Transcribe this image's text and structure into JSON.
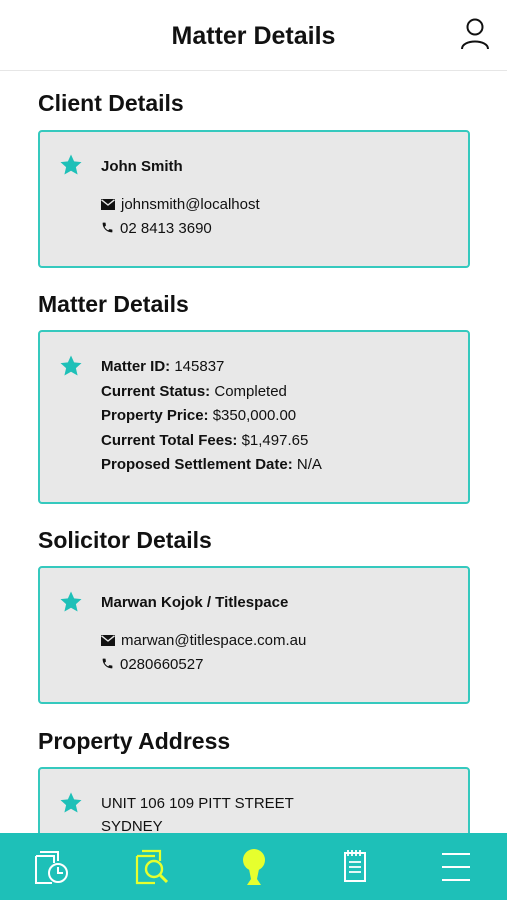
{
  "header": {
    "title": "Matter Details",
    "profile_icon": "user-icon"
  },
  "sections": {
    "client": {
      "title": "Client Details",
      "name": "John Smith",
      "email": "johnsmith@localhost",
      "phone": "02 8413 3690"
    },
    "matter": {
      "title": "Matter Details",
      "rows": [
        {
          "label": "Matter ID:",
          "value": "145837"
        },
        {
          "label": "Current Status:",
          "value": "Completed"
        },
        {
          "label": "Property Price:",
          "value": "$350,000.00"
        },
        {
          "label": "Current Total Fees:",
          "value": "$1,497.65"
        },
        {
          "label": "Proposed Settlement Date:",
          "value": "N/A"
        }
      ]
    },
    "solicitor": {
      "title": "Solicitor Details",
      "name": "Marwan Kojok / Titlespace",
      "email": "marwan@titlespace.com.au",
      "phone": "0280660527"
    },
    "property": {
      "title": "Property Address",
      "line1": "UNIT 106 109 PITT STREET",
      "line2": "SYDNEY"
    }
  },
  "bottom_nav": {
    "items": [
      "history-icon",
      "search-document-icon",
      "location-pin-icon",
      "notepad-icon",
      "menu-icon"
    ],
    "active_color": "#e6ff2e",
    "icon_color": "#ffffff"
  },
  "colors": {
    "accent": "#1ec0b8",
    "card_border": "#35c9be",
    "card_bg": "#e8e8e8"
  }
}
